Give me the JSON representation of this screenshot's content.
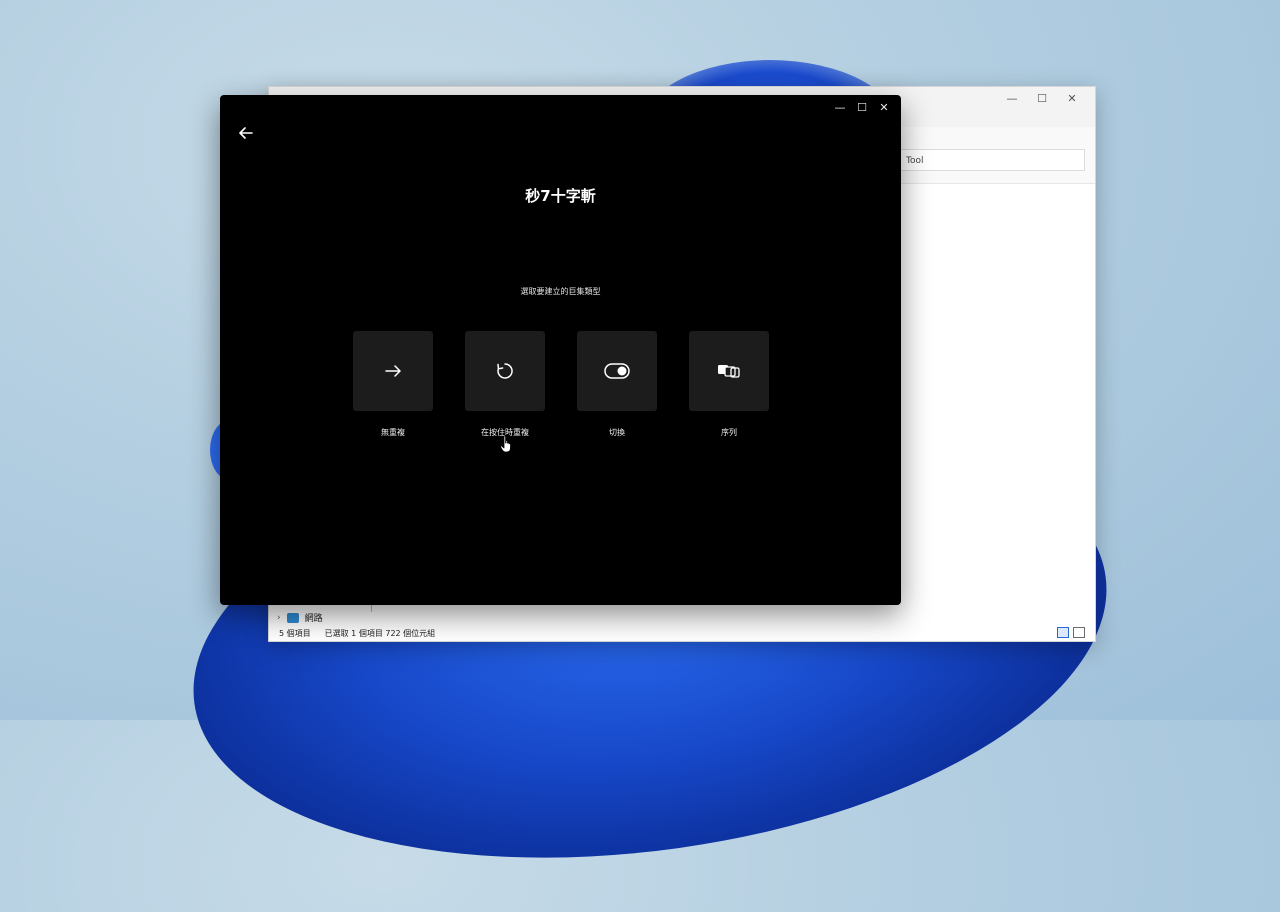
{
  "background_window": {
    "minimize": "—",
    "maximize": "☐",
    "close": "✕",
    "search_value": "Tool",
    "nav_item": "網路",
    "status": {
      "item_count": "5 個項目",
      "selection": "已選取 1 個項目 722 個位元組"
    }
  },
  "app": {
    "minimize": "—",
    "maximize": "☐",
    "close": "✕",
    "title": "秒7十字斬",
    "subtitle": "選取要建立的巨集類型",
    "tiles": [
      {
        "label": "無重複",
        "icon": "arrow-right-icon"
      },
      {
        "label": "在按住時重複",
        "icon": "rotate-icon"
      },
      {
        "label": "切換",
        "icon": "toggle-icon"
      },
      {
        "label": "序列",
        "icon": "sequence-icon"
      }
    ]
  }
}
